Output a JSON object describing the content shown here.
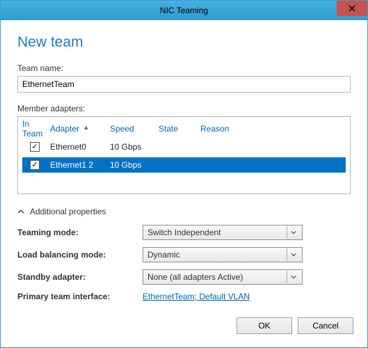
{
  "window": {
    "title": "NIC Teaming"
  },
  "page": {
    "heading": "New team"
  },
  "teamName": {
    "label": "Team name:",
    "value": "EthernetTeam"
  },
  "memberAdapters": {
    "label": "Member adapters:",
    "columns": {
      "inTeam": "In Team",
      "adapter": "Adapter",
      "speed": "Speed",
      "state": "State",
      "reason": "Reason"
    },
    "rows": [
      {
        "checked": true,
        "adapter": "Ethernet0",
        "speed": "10 Gbps",
        "state": "",
        "reason": "",
        "selected": false
      },
      {
        "checked": true,
        "adapter": "Ethernet1 2",
        "speed": "10 Gbps",
        "state": "",
        "reason": "",
        "selected": true
      }
    ]
  },
  "additional": {
    "toggleLabel": "Additional properties",
    "teamingMode": {
      "label": "Teaming mode:",
      "value": "Switch Independent"
    },
    "loadBalancing": {
      "label": "Load balancing mode:",
      "value": "Dynamic"
    },
    "standby": {
      "label": "Standby adapter:",
      "value": "None (all adapters Active)"
    },
    "primaryIf": {
      "label": "Primary team interface:",
      "link": "EthernetTeam; Default VLAN"
    }
  },
  "buttons": {
    "ok": "OK",
    "cancel": "Cancel"
  }
}
